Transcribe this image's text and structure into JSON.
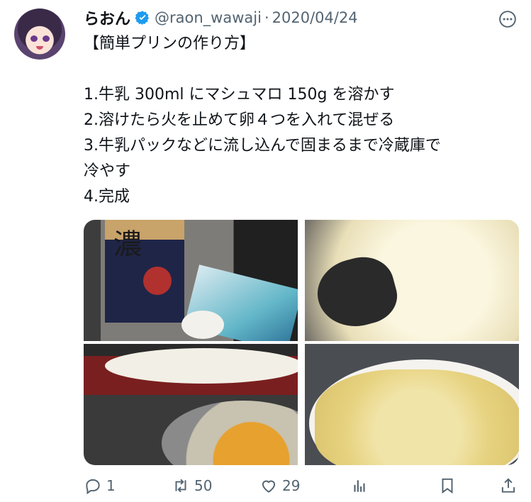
{
  "tweet": {
    "author_name": "らおん",
    "handle": "@raon_wawaji",
    "separator": "·",
    "date": "2020/04/24",
    "text_lines": [
      "【簡単プリンの作り方】",
      "",
      "1.牛乳 300ml にマシュマロ 150g を溶かす",
      "2.溶けたら火を止めて卵４つを入れて混ぜる",
      "3.牛乳パックなどに流し込んで固まるまで冷蔵庫で",
      "冷やす",
      "4.完成"
    ],
    "photo_texts": {
      "carton_kanji": "濃"
    }
  },
  "actions": {
    "reply_count": "1",
    "retweet_count": "50",
    "like_count": "29"
  },
  "colors": {
    "verified": "#1d9bf0",
    "muted": "#536471",
    "text": "#0f1419"
  },
  "icons": [
    "verified-badge-icon",
    "more-icon",
    "reply-icon",
    "retweet-icon",
    "like-icon",
    "views-icon",
    "bookmark-icon",
    "share-icon"
  ]
}
